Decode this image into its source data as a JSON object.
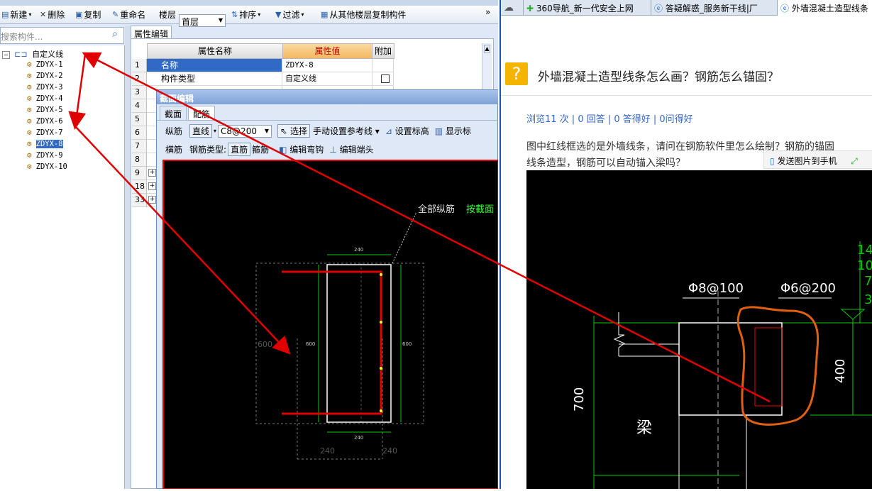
{
  "toolbar": {
    "new_label": "新建",
    "delete_label": "删除",
    "copy_label": "复制",
    "rename_label": "重命名",
    "floor_label": "楼层",
    "floor_value": "首层",
    "sort_label": "排序",
    "filter_label": "过滤",
    "copy_from_label": "从其他楼层复制构件",
    "more": "»"
  },
  "search": {
    "placeholder": "搜索构件..."
  },
  "tree": {
    "root": "自定义线",
    "items": [
      "ZDYX-1",
      "ZDYX-2",
      "ZDYX-3",
      "ZDYX-4",
      "ZDYX-5",
      "ZDYX-6",
      "ZDYX-7",
      "ZDYX-8",
      "ZDYX-9",
      "ZDYX-10"
    ],
    "selected": "ZDYX-8"
  },
  "props": {
    "tab": "属性编辑",
    "col_name": "属性名称",
    "col_value": "属性值",
    "col_extra": "附加",
    "rows": [
      {
        "n": "1",
        "name": "名称",
        "value": "ZDYX-8"
      },
      {
        "n": "2",
        "name": "构件类型",
        "value": "自定义线"
      },
      {
        "n": "3",
        "name": "",
        "value": ""
      },
      {
        "n": "4",
        "name": "",
        "value": ""
      },
      {
        "n": "5",
        "name": "",
        "value": ""
      },
      {
        "n": "6",
        "name": "",
        "value": ""
      },
      {
        "n": "7",
        "name": "",
        "value": ""
      },
      {
        "n": "8",
        "name": "",
        "value": ""
      },
      {
        "n": "9",
        "name": "",
        "value": ""
      },
      {
        "n": "18",
        "name": "",
        "value": ""
      },
      {
        "n": "33",
        "name": "",
        "value": ""
      }
    ],
    "plus": "+"
  },
  "dialog": {
    "title": "截面编辑",
    "tab_section": "截面",
    "tab_rebar": "配筋",
    "longitudinal": "纵筋",
    "straight": "直线",
    "rebar_spec": "C8@200",
    "select": "选择",
    "manual_ref": "手动设置参考线",
    "set_elev": "设置标高",
    "show_label": "显示标",
    "transverse": "横筋",
    "rebar_type": "钢筋类型:",
    "straight_rebar": "直筋",
    "stirrup": "箍筋",
    "edit_bend": "编辑弯钩",
    "edit_end": "编辑端头",
    "all_long": "全部纵筋",
    "by_section": "按截面",
    "dim_240": "240",
    "dim_600": "600"
  },
  "browser": {
    "tabs": [
      "360导航_新一代安全上网",
      "答疑解惑_服务新干线|厂",
      "外墙混凝土造型线条"
    ],
    "question_icon": "?",
    "question_title": "外墙混凝土造型线条怎么画？钢筋怎么锚固？",
    "stats": "浏览11 次 | 0 回答 | 0 答得好 | 0问得好",
    "body_line1": "图中红线框选的是外墙线条，请问在钢筋软件里怎么绘制？钢筋的锚固",
    "body_line2": "线条造型，钢筋可以自动锚入梁吗？",
    "send_to_phone": "发送图片到手机",
    "cad_labels": {
      "a": "Φ8@100",
      "b": "Φ6@200",
      "h700": "700",
      "h400": "400",
      "beam": "梁",
      "r1": "14.",
      "r2": "10.",
      "r3": "7",
      "r4": "3"
    }
  },
  "colors": {
    "accent": "#3169c6",
    "red": "#e00000",
    "orange": "#e06010",
    "cad_green": "#00d000"
  }
}
